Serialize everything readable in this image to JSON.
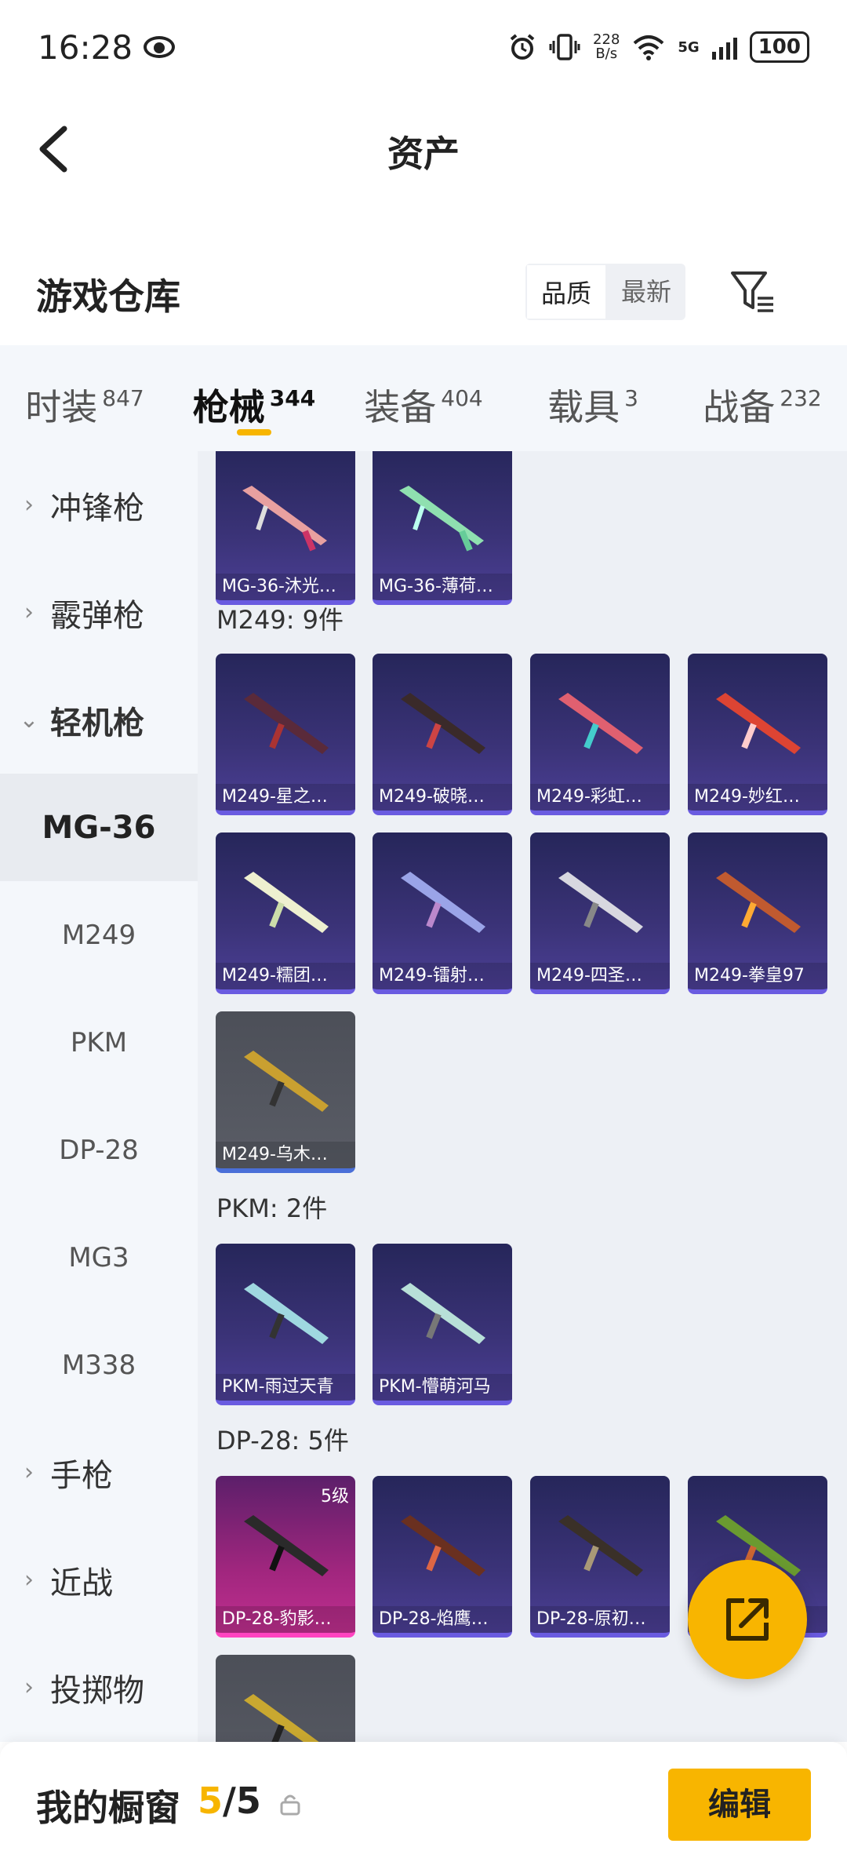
{
  "status_bar": {
    "time": "16:28",
    "net_speed_value": "228",
    "net_speed_unit": "B/s",
    "network": "5G",
    "battery": "100"
  },
  "header": {
    "title": "资产"
  },
  "warehouse": {
    "title": "游戏仓库",
    "sort_options": [
      "品质",
      "最新"
    ],
    "active_sort": "品质"
  },
  "tabs": [
    {
      "label": "时装",
      "count": "847"
    },
    {
      "label": "枪械",
      "count": "344",
      "active": true
    },
    {
      "label": "装备",
      "count": "404"
    },
    {
      "label": "载具",
      "count": "3"
    },
    {
      "label": "战备",
      "count": "232"
    }
  ],
  "sidebar": {
    "categories": [
      {
        "label": "冲锋枪"
      },
      {
        "label": "霰弹枪"
      },
      {
        "label": "轻机枪"
      }
    ],
    "subitems": [
      "MG-36",
      "M249",
      "PKM",
      "DP-28",
      "MG3",
      "M338"
    ],
    "selected": "MG-36",
    "more": [
      {
        "label": "手枪"
      },
      {
        "label": "近战"
      },
      {
        "label": "投掷物"
      }
    ]
  },
  "groups": {
    "mg36": {
      "items": [
        "MG-36-沐光…",
        "MG-36-薄荷…"
      ]
    },
    "m249": {
      "label": "M249: 9件",
      "items": [
        "M249-星之…",
        "M249-破晓…",
        "M249-彩虹…",
        "M249-妙红…",
        "M249-糯团…",
        "M249-镭射…",
        "M249-四圣…",
        "M249-拳皇97",
        "M249-乌木…"
      ]
    },
    "pkm": {
      "label": "PKM: 2件",
      "items": [
        "PKM-雨过天青",
        "PKM-懵萌河马"
      ]
    },
    "dp28": {
      "label": "DP-28: 5件",
      "items": [
        "DP-28-豹影…",
        "DP-28-焰鹰…",
        "DP-28-原初…",
        "",
        ""
      ],
      "level": "5级"
    }
  },
  "bottom": {
    "window_label": "我的橱窗",
    "current": "5",
    "separator": "/",
    "total": "5",
    "edit_label": "编辑"
  }
}
